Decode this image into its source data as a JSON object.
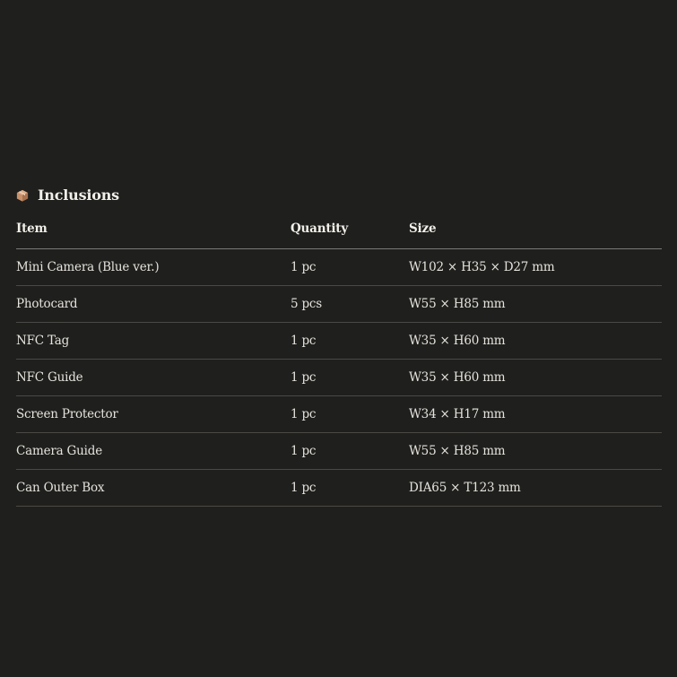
{
  "section": {
    "icon": "package-icon",
    "title": "Inclusions"
  },
  "table": {
    "headers": {
      "item": "Item",
      "quantity": "Quantity",
      "size": "Size"
    },
    "rows": [
      {
        "item": "Mini Camera (Blue ver.)",
        "quantity": "1 pc",
        "size": "W102 × H35 × D27 mm"
      },
      {
        "item": "Photocard",
        "quantity": "5 pcs",
        "size": "W55 × H85 mm"
      },
      {
        "item": "NFC Tag",
        "quantity": "1 pc",
        "size": "W35 × H60 mm"
      },
      {
        "item": "NFC Guide",
        "quantity": "1 pc",
        "size": "W35 × H60 mm"
      },
      {
        "item": "Screen Protector",
        "quantity": "1 pc",
        "size": "W34 × H17 mm"
      },
      {
        "item": "Camera Guide",
        "quantity": "1 pc",
        "size": "W55 × H85 mm"
      },
      {
        "item": "Can Outer Box",
        "quantity": "1 pc",
        "size": "DIA65 × T123 mm"
      }
    ]
  },
  "colors": {
    "background": "#1f1f1d",
    "text": "#e6e3dd",
    "divider": "#4a4945",
    "icon": "#c8926b"
  }
}
